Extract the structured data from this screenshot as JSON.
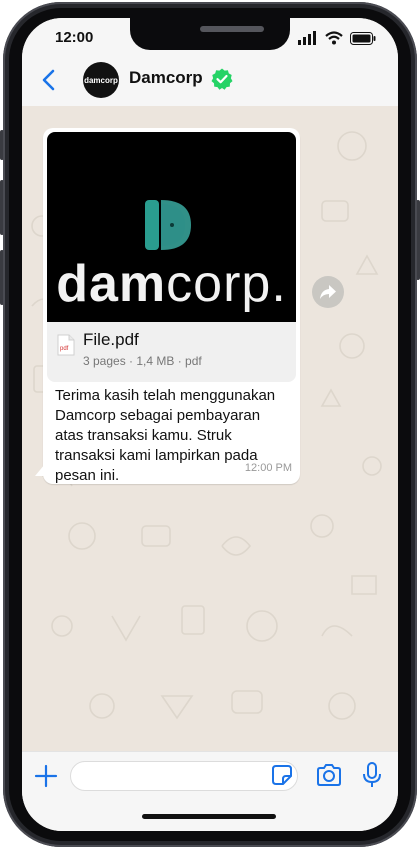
{
  "status_bar": {
    "time": "12:00"
  },
  "header": {
    "contact_name": "Damcorp",
    "avatar_text": "damcorp"
  },
  "message": {
    "preview_logo_text_bold": "dam",
    "preview_logo_text_light": "corp.",
    "file_name": "File.pdf",
    "file_meta": "3 pages · 1,4 MB · pdf",
    "pdf_badge": "pdf",
    "text": "Terima kasih telah menggunakan Damcorp sebagai pembayaran atas transaksi kamu. Struk transaksi kami lampirkan pada pesan ini.",
    "time": "12:00 PM"
  },
  "input": {
    "placeholder": "",
    "value": ""
  },
  "colors": {
    "accent": "#1a73e8",
    "verified": "#25d366",
    "chat_bg": "#ece5dd",
    "logo_teal": "#2a9d8f"
  },
  "icons": [
    "back-chevron-icon",
    "verified-badge-icon",
    "forward-icon",
    "pdf-icon",
    "plus-icon",
    "sticker-icon",
    "camera-icon",
    "mic-icon",
    "signal-icon",
    "wifi-icon",
    "battery-icon"
  ]
}
